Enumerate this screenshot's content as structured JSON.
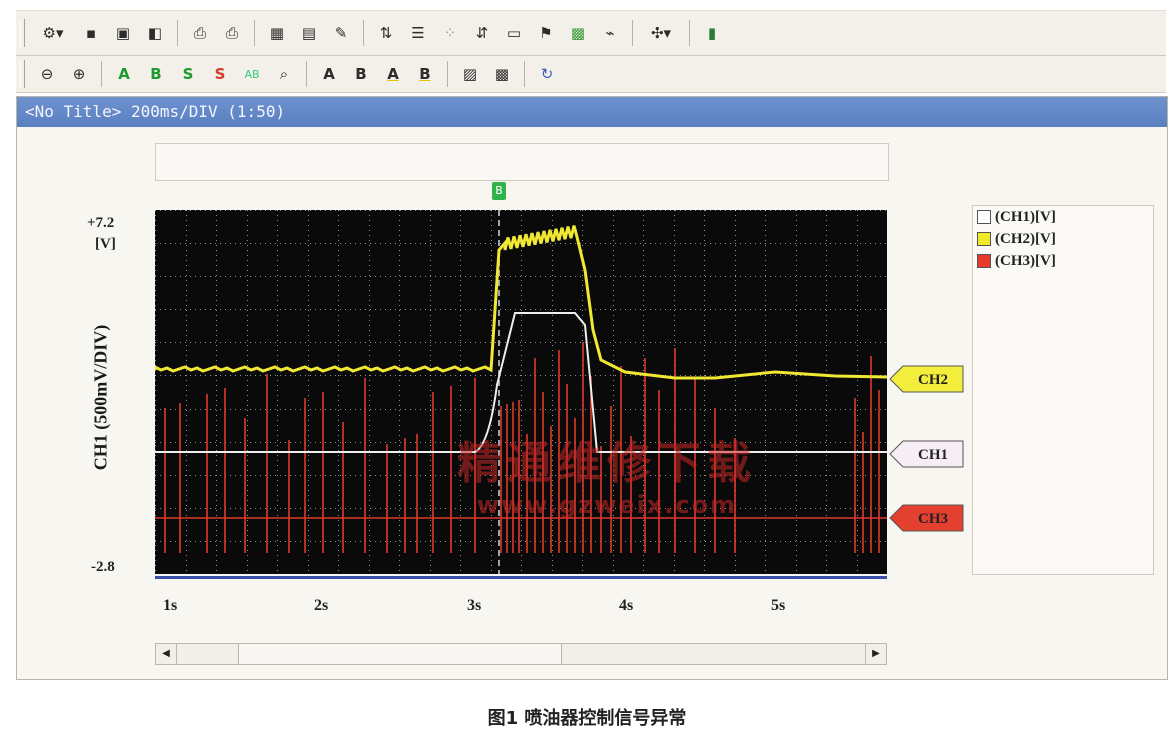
{
  "toolbar1": {
    "buttons": [
      "settings-icon",
      "save-icon",
      "save-as-icon",
      "save-all-icon",
      "print-icon",
      "print-preview-icon",
      "chart-icon",
      "table-icon",
      "edit-icon",
      "channel-icon",
      "sliders-icon",
      "xy-icon",
      "sync-icon",
      "properties-icon",
      "flag-icon",
      "calculator-icon",
      "scope-icon",
      "tools-icon",
      "exit-icon"
    ]
  },
  "toolbar2": {
    "labels": {
      "cursor_a": "A",
      "cursor_b": "B",
      "cursor_sa": "S",
      "cursor_sb": "S",
      "ab": "AB",
      "text_a": "A",
      "text_b": "B",
      "underline_a": "A",
      "underline_b": "B"
    }
  },
  "window": {
    "title": "<No Title> 200ms/DIV (1:50)"
  },
  "marker": {
    "label": "B"
  },
  "axis": {
    "y_top": "+7.2",
    "y_unit": "[V]",
    "y_bottom": "-2.8",
    "y_label": "CH1 (500mV/DIV)",
    "x_ticks": [
      "1s",
      "2s",
      "3s",
      "4s",
      "5s"
    ]
  },
  "legend": [
    {
      "label": "(CH1)[V]",
      "color": "#ffffff"
    },
    {
      "label": "(CH2)[V]",
      "color": "#f1ea2b"
    },
    {
      "label": "(CH3)[V]",
      "color": "#e6392b"
    }
  ],
  "channel_tags": [
    {
      "label": "CH2",
      "color": "#f3ee3c"
    },
    {
      "label": "CH1",
      "color": "#f6eef4"
    },
    {
      "label": "CH3",
      "color": "#e4402f"
    }
  ],
  "watermark": {
    "line1": "精通维修下载",
    "line2": "www.gzweix.com"
  },
  "caption": "图1 喷油器控制信号异常",
  "colors": {
    "title_bar": "#5a7fc0",
    "plot_bg": "#0a0a0a",
    "grid": "#ffffff"
  }
}
